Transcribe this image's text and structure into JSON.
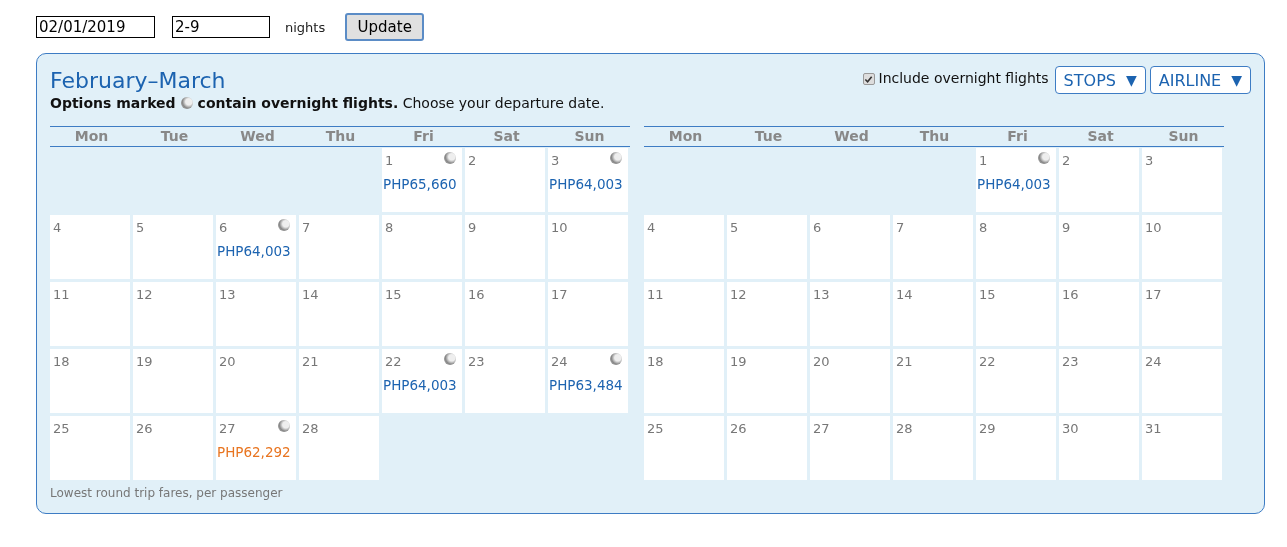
{
  "search": {
    "date": "02/01/2019",
    "nights_value": "2-9",
    "nights_label": "nights",
    "update_button": "Update"
  },
  "panel": {
    "title": "February–March",
    "legend_start": "Options marked",
    "legend_end": "**contain overnight flights.** Choose your departure date.",
    "include_overnight": {
      "label": "Include overnight flights",
      "checked": true
    },
    "filters": [
      {
        "label": "STOPS",
        "caret": "▼"
      },
      {
        "label": "AIRLINE",
        "caret": "▼"
      }
    ],
    "months": [
      {
        "weekdays": [
          "Mon",
          "Tue",
          "Wed",
          "Thu",
          "Fri",
          "Sat",
          "Sun"
        ],
        "weeks": [
          [
            {
              "kind": "blank"
            },
            {
              "kind": "blank"
            },
            {
              "kind": "blank"
            },
            {
              "kind": "blank"
            },
            {
              "kind": "day",
              "day": "1",
              "overnight": true,
              "price": "PHP65,660",
              "lowest": false
            },
            {
              "kind": "day",
              "day": "2"
            },
            {
              "kind": "day",
              "day": "3",
              "overnight": true,
              "price": "PHP64,003",
              "lowest": false
            }
          ],
          [
            {
              "kind": "day",
              "day": "4"
            },
            {
              "kind": "day",
              "day": "5"
            },
            {
              "kind": "day",
              "day": "6",
              "overnight": true,
              "price": "PHP64,003",
              "lowest": false
            },
            {
              "kind": "day",
              "day": "7"
            },
            {
              "kind": "day",
              "day": "8"
            },
            {
              "kind": "day",
              "day": "9"
            },
            {
              "kind": "day",
              "day": "10"
            }
          ],
          [
            {
              "kind": "day",
              "day": "11"
            },
            {
              "kind": "day",
              "day": "12"
            },
            {
              "kind": "day",
              "day": "13"
            },
            {
              "kind": "day",
              "day": "14"
            },
            {
              "kind": "day",
              "day": "15"
            },
            {
              "kind": "day",
              "day": "16"
            },
            {
              "kind": "day",
              "day": "17"
            }
          ],
          [
            {
              "kind": "day",
              "day": "18"
            },
            {
              "kind": "day",
              "day": "19"
            },
            {
              "kind": "day",
              "day": "20"
            },
            {
              "kind": "day",
              "day": "21"
            },
            {
              "kind": "day",
              "day": "22",
              "overnight": true,
              "price": "PHP64,003",
              "lowest": false
            },
            {
              "kind": "day",
              "day": "23"
            },
            {
              "kind": "day",
              "day": "24",
              "overnight": true,
              "price": "PHP63,484",
              "lowest": false
            }
          ],
          [
            {
              "kind": "day",
              "day": "25"
            },
            {
              "kind": "day",
              "day": "26"
            },
            {
              "kind": "day",
              "day": "27",
              "overnight": true,
              "price": "PHP62,292",
              "lowest": true
            },
            {
              "kind": "day",
              "day": "28"
            },
            {
              "kind": "blank"
            },
            {
              "kind": "blank"
            },
            {
              "kind": "blank"
            }
          ]
        ]
      },
      {
        "weekdays": [
          "Mon",
          "Tue",
          "Wed",
          "Thu",
          "Fri",
          "Sat",
          "Sun"
        ],
        "weeks": [
          [
            {
              "kind": "blank"
            },
            {
              "kind": "blank"
            },
            {
              "kind": "blank"
            },
            {
              "kind": "blank"
            },
            {
              "kind": "day",
              "day": "1",
              "overnight": true,
              "price": "PHP64,003",
              "lowest": false
            },
            {
              "kind": "day",
              "day": "2"
            },
            {
              "kind": "day",
              "day": "3"
            }
          ],
          [
            {
              "kind": "day",
              "day": "4"
            },
            {
              "kind": "day",
              "day": "5"
            },
            {
              "kind": "day",
              "day": "6"
            },
            {
              "kind": "day",
              "day": "7"
            },
            {
              "kind": "day",
              "day": "8"
            },
            {
              "kind": "day",
              "day": "9"
            },
            {
              "kind": "day",
              "day": "10"
            }
          ],
          [
            {
              "kind": "day",
              "day": "11"
            },
            {
              "kind": "day",
              "day": "12"
            },
            {
              "kind": "day",
              "day": "13"
            },
            {
              "kind": "day",
              "day": "14"
            },
            {
              "kind": "day",
              "day": "15"
            },
            {
              "kind": "day",
              "day": "16"
            },
            {
              "kind": "day",
              "day": "17"
            }
          ],
          [
            {
              "kind": "day",
              "day": "18"
            },
            {
              "kind": "day",
              "day": "19"
            },
            {
              "kind": "day",
              "day": "20"
            },
            {
              "kind": "day",
              "day": "21"
            },
            {
              "kind": "day",
              "day": "22"
            },
            {
              "kind": "day",
              "day": "23"
            },
            {
              "kind": "day",
              "day": "24"
            }
          ],
          [
            {
              "kind": "day",
              "day": "25"
            },
            {
              "kind": "day",
              "day": "26"
            },
            {
              "kind": "day",
              "day": "27"
            },
            {
              "kind": "day",
              "day": "28"
            },
            {
              "kind": "day",
              "day": "29"
            },
            {
              "kind": "day",
              "day": "30"
            },
            {
              "kind": "day",
              "day": "31"
            }
          ]
        ]
      }
    ],
    "footnote": "Lowest round trip fares, per passenger"
  }
}
